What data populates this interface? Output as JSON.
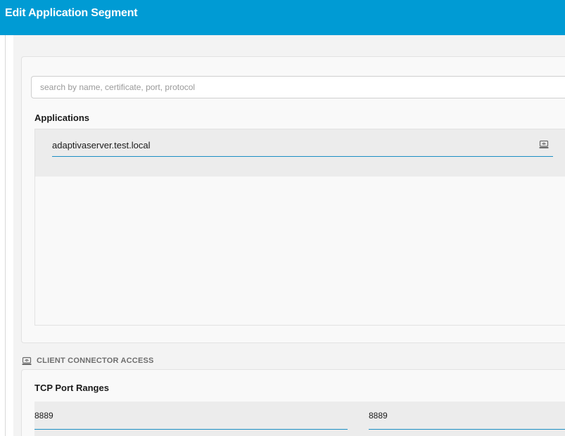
{
  "header": {
    "title": "Edit Application Segment"
  },
  "search": {
    "placeholder": "search by name, certificate, port, protocol",
    "value": ""
  },
  "applications": {
    "label": "Applications",
    "items": [
      {
        "name": "adaptivaserver.test.local",
        "icon": "client-connector-icon"
      }
    ]
  },
  "client_connector": {
    "section_label": "CLIENT CONNECTOR ACCESS",
    "icon": "client-connector-icon",
    "tcp_label": "TCP Port Ranges",
    "port_from": "8889",
    "port_to": "8889"
  },
  "colors": {
    "header_bg": "#009bd4",
    "accent_underline": "#1c8fc4",
    "panel_bg": "#f9f9f9",
    "row_bg": "#ececec"
  }
}
